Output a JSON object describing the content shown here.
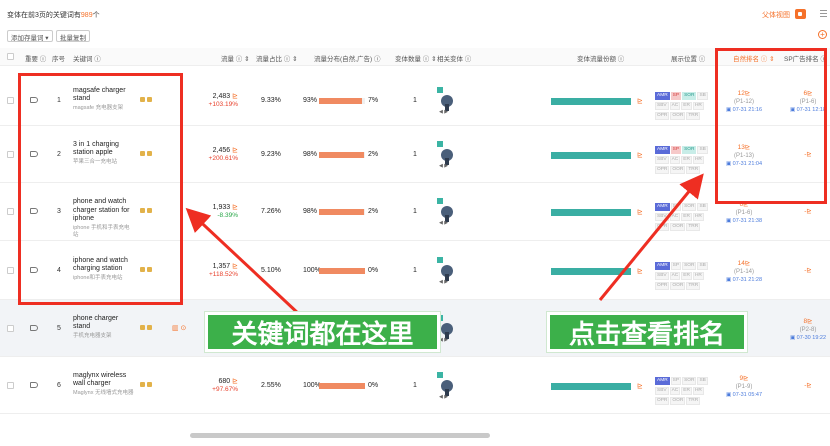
{
  "header": {
    "summary_prefix": "变体在前3页的关键词有",
    "summary_count": "989",
    "summary_suffix": "个",
    "view_label": "父体视图",
    "btn_add": "添加存量词 ▾",
    "btn_copy": "批量复制"
  },
  "columns": {
    "emphasis": "重要 ⓘ",
    "no": "序号",
    "keyword": "关键词 ⓘ",
    "traffic": "流量 ⓘ ⇕",
    "share": "流量占比 ⓘ ⇕",
    "distribution": "流量分布(自然,广告) ⓘ",
    "variant_count": "变体数量 ⓘ ⇕",
    "related_variant": "相关变体 ⓘ",
    "variant_traffic": "变体流量份额 ⓘ",
    "position": "展示位置 ⓘ",
    "natural_rank": "自然排名 ⓘ ⇕",
    "sp_rank": "SP广告排名 ⓘ"
  },
  "badge_labels": [
    "AMR",
    "SP",
    "SOR",
    "SB",
    "SBV",
    "AC",
    "ER",
    "HR",
    "OPR",
    "OOR",
    "TRR"
  ],
  "rows": [
    {
      "no": "1",
      "kw": "magsafe charger stand",
      "cn": "magsafe 充电器支架",
      "traffic": "2,483",
      "chg": "+103.19%",
      "dir": "up",
      "share": "9.33%",
      "nat_pct": 93,
      "nat": "93%",
      "ad": "7%",
      "vc": "1",
      "vt": 80,
      "nat_rank": "12",
      "nat_pg": "(P1-12)",
      "nat_dt": "▣ 07-31 21:16",
      "sp_rank": "6",
      "sp_pg": "(P1-6)",
      "sp_dt": "▣ 07-31 12:18",
      "on": [
        0,
        1,
        2,
        3
      ]
    },
    {
      "no": "2",
      "kw": "3 in 1 charging station apple",
      "cn": "苹果三合一充电站",
      "traffic": "2,456",
      "chg": "+200.61%",
      "dir": "up",
      "share": "9.23%",
      "nat_pct": 98,
      "nat": "98%",
      "ad": "2%",
      "vc": "1",
      "vt": 80,
      "nat_rank": "13",
      "nat_pg": "(P1-13)",
      "nat_dt": "▣ 07-31 21:04",
      "sp_rank": "",
      "sp_pg": "",
      "sp_dt": "",
      "on": [
        0,
        1,
        2,
        3
      ]
    },
    {
      "no": "3",
      "kw": "phone and watch charger station for iphone",
      "cn": "iphone 手机和手表充电站",
      "traffic": "1,933",
      "chg": "-8.39%",
      "dir": "down",
      "share": "7.26%",
      "nat_pct": 98,
      "nat": "98%",
      "ad": "2%",
      "vc": "1",
      "vt": 80,
      "nat_rank": "6",
      "nat_pg": "(P1-6)",
      "nat_dt": "▣ 07-31 21:38",
      "sp_rank": "",
      "sp_pg": "",
      "sp_dt": "",
      "on": [
        0
      ]
    },
    {
      "no": "4",
      "kw": "iphone and watch charging station",
      "cn": "iphone和手表充电站",
      "traffic": "1,357",
      "chg": "+118.52%",
      "dir": "up",
      "share": "5.10%",
      "nat_pct": 100,
      "nat": "100%",
      "ad": "0%",
      "vc": "1",
      "vt": 80,
      "nat_rank": "14",
      "nat_pg": "(P1-14)",
      "nat_dt": "▣ 07-31 21:28",
      "sp_rank": "",
      "sp_pg": "",
      "sp_dt": "",
      "on": [
        0
      ]
    },
    {
      "no": "5",
      "kw": "phone charger stand",
      "cn": "手机充电器支架",
      "traffic": "",
      "chg": "",
      "dir": "up",
      "share": "",
      "nat_pct": 0,
      "nat": "",
      "ad": "",
      "vc": "",
      "vt": 0,
      "nat_rank": "",
      "nat_pg": "",
      "nat_dt": "",
      "sp_rank": "8",
      "sp_pg": "(P2-8)",
      "sp_dt": "▣ 07-30 19:22",
      "on": []
    },
    {
      "no": "6",
      "kw": "maglynx wireless wall charger",
      "cn": "Maglynx 无线墙式充电器",
      "traffic": "680",
      "chg": "+97.67%",
      "dir": "up",
      "share": "2.55%",
      "nat_pct": 100,
      "nat": "100%",
      "ad": "0%",
      "vc": "1",
      "vt": 80,
      "nat_rank": "9",
      "nat_pg": "(P1-9)",
      "nat_dt": "▣ 07-31 05:47",
      "sp_rank": "",
      "sp_pg": "",
      "sp_dt": "",
      "on": [
        0
      ]
    }
  ],
  "annotations": {
    "left": "关键词都在这里",
    "right": "点击查看排名"
  }
}
